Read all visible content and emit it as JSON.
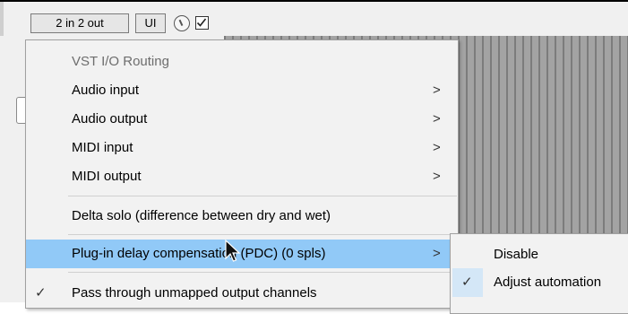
{
  "toolbar": {
    "io_label": "2 in 2 out",
    "ui_label": "UI"
  },
  "menu": {
    "header": "VST I/O Routing",
    "items": [
      {
        "label": "Audio input",
        "has_submenu": true
      },
      {
        "label": "Audio output",
        "has_submenu": true
      },
      {
        "label": "MIDI input",
        "has_submenu": true
      },
      {
        "label": "MIDI output",
        "has_submenu": true
      },
      {
        "label": "Delta solo (difference between dry and wet)",
        "has_submenu": false
      },
      {
        "label": "Plug-in delay compensation (PDC) (0 spls)",
        "has_submenu": true,
        "highlighted": true
      },
      {
        "label": "Pass through unmapped output channels",
        "has_submenu": false,
        "checked": true
      }
    ],
    "arrow_glyph": ">",
    "check_glyph": "✓"
  },
  "submenu": {
    "items": [
      {
        "label": "Disable",
        "checked": false
      },
      {
        "label": "Adjust automation",
        "checked": true
      }
    ]
  },
  "colors": {
    "highlight": "#91c9f7",
    "menu_bg": "#f2f2f2",
    "header_text": "#6d6d6d"
  }
}
